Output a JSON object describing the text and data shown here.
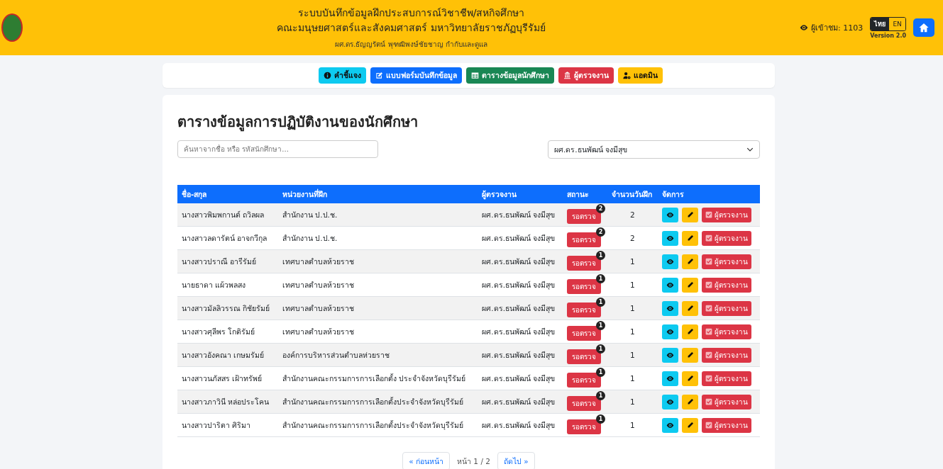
{
  "header": {
    "title_lines": [
      "ระบบบันทึกข้อมูลฝึกประสบการณ์วิชาชีพ/สหกิจศึกษา",
      "คณะมนุษยศาสตร์และสังคมศาสตร์ มหาวิทยาลัยราชภัฏบุรีรัมย์"
    ],
    "subtitle": "ผศ.ดร.ธัญญรัตน์ พุฑฒิพงษ์ชัยชาญ กำกับและดูแล",
    "visitors": "ผู้เข้าชม: 1103",
    "languages": [
      {
        "label": "ไทย",
        "selected": true
      },
      {
        "label": "EN",
        "selected": false
      }
    ],
    "version": "Version 2.0"
  },
  "nav": [
    {
      "label": "คำชี้แจง",
      "kind": "info"
    },
    {
      "label": "แบบฟอร์มบันทึกข้อมูล",
      "kind": "form"
    },
    {
      "label": "ตารางข้อมูลนักศึกษา",
      "kind": "table"
    },
    {
      "label": "ผู้ตรวจงาน",
      "kind": "reviewer"
    },
    {
      "label": "แอดมิน",
      "kind": "admin"
    }
  ],
  "page_title": "ตารางข้อมูลการปฏิบัติงานของนักศึกษา",
  "search": {
    "placeholder": "ค้นหาจากชื่อ หรือ รหัสนักศึกษา..."
  },
  "filter": {
    "value": "ผศ.ดร.ธนพัฒน์ จงมีสุข"
  },
  "table": {
    "columns": [
      "ชื่อ-สกุล",
      "หน่วยงานที่ฝึก",
      "ผู้ตรวจงาน",
      "สถานะ",
      "จำนวนวันฝึก",
      "จัดการ"
    ],
    "rows": [
      {
        "name": "นางสาวพิมพกานต์ ถวิลผล",
        "unit": "สำนักงาน ป.ป.ช.",
        "reviewer": "ผศ.ดร.ธนพัฒน์ จงมีสุข",
        "status": "รอตรวจ",
        "pending": "2",
        "days": "2",
        "action": "ผู้ตรวจงาน"
      },
      {
        "name": "นางสาวลดารัตน์ อาจกวีกุล",
        "unit": "สำนักงาน ป.ป.ช.",
        "reviewer": "ผศ.ดร.ธนพัฒน์ จงมีสุข",
        "status": "รอตรวจ",
        "pending": "2",
        "days": "2",
        "action": "ผู้ตรวจงาน"
      },
      {
        "name": "นางสาวปราณี อารีรัมย์",
        "unit": "เทศบาลตำบลห้วยราช",
        "reviewer": "ผศ.ดร.ธนพัฒน์ จงมีสุข",
        "status": "รอตรวจ",
        "pending": "1",
        "days": "1",
        "action": "ผู้ตรวจงาน"
      },
      {
        "name": "นายธาดา แผ้วพลสง",
        "unit": "เทศบาลตำบลห้วยราช",
        "reviewer": "ผศ.ดร.ธนพัฒน์ จงมีสุข",
        "status": "รอตรวจ",
        "pending": "1",
        "days": "1",
        "action": "ผู้ตรวจงาน"
      },
      {
        "name": "นางสาวมัลลิวรรณ กิชัยรัมย์",
        "unit": "เทศบาลตำบลห้วยราช",
        "reviewer": "ผศ.ดร.ธนพัฒน์ จงมีสุข",
        "status": "รอตรวจ",
        "pending": "1",
        "days": "1",
        "action": "ผู้ตรวจงาน"
      },
      {
        "name": "นางสาวศุลีพร โกติรัมย์",
        "unit": "เทศบาลตำบลห้วยราช",
        "reviewer": "ผศ.ดร.ธนพัฒน์ จงมีสุข",
        "status": "รอตรวจ",
        "pending": "1",
        "days": "1",
        "action": "ผู้ตรวจงาน"
      },
      {
        "name": "นางสาวอังคณา เกษมรัมย์",
        "unit": "องค์การบริหารส่วนตำบลห่วยราช",
        "reviewer": "ผศ.ดร.ธนพัฒน์ จงมีสุข",
        "status": "รอตรวจ",
        "pending": "1",
        "days": "1",
        "action": "ผู้ตรวจงาน"
      },
      {
        "name": "นางสาวนภัสสร เฝ้าทรัพย์",
        "unit": "สำนักงานคณะกรรมการการเลือกตั้ง ประจำจังหวัดบุรีรัมย์",
        "reviewer": "ผศ.ดร.ธนพัฒน์ จงมีสุข",
        "status": "รอตรวจ",
        "pending": "1",
        "days": "1",
        "action": "ผู้ตรวจงาน"
      },
      {
        "name": "นางสาวภาวินี หล่อประโคน",
        "unit": "สำนักงานคณะกรรมการการเลือกตั้งประจำจังหวัดบุรีรัมย์",
        "reviewer": "ผศ.ดร.ธนพัฒน์ จงมีสุข",
        "status": "รอตรวจ",
        "pending": "1",
        "days": "1",
        "action": "ผู้ตรวจงาน"
      },
      {
        "name": "นางสาวปาริตา ศิริมา",
        "unit": "สำนักงานคณะกรรมการการเลือกตั้งประจำจังหวัดบุรีรัมย์",
        "reviewer": "ผศ.ดร.ธนพัฒน์ จงมีสุข",
        "status": "รอตรวจ",
        "pending": "1",
        "days": "1",
        "action": "ผู้ตรวจงาน"
      }
    ]
  },
  "pagination": {
    "previous": "« ก่อนหน้า",
    "page": "หน้า 1 / 2",
    "next": "ถัดไป »"
  }
}
